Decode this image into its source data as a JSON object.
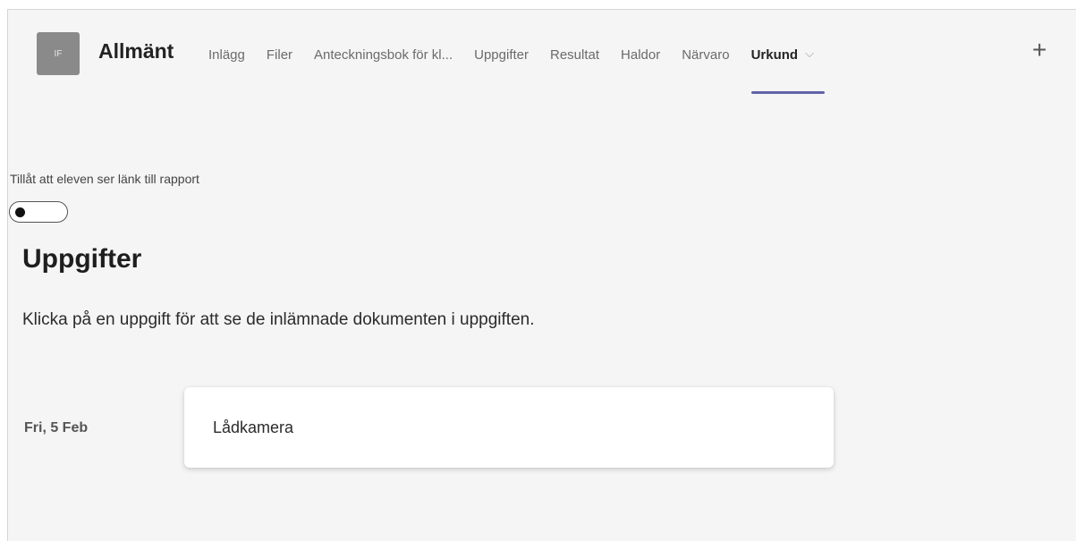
{
  "header": {
    "avatar_initials": "IF",
    "channel_title": "Allmänt",
    "tabs": [
      {
        "label": "Inlägg"
      },
      {
        "label": "Filer"
      },
      {
        "label": "Anteckningsbok för kl..."
      },
      {
        "label": "Uppgifter"
      },
      {
        "label": "Resultat"
      },
      {
        "label": "Haldor"
      },
      {
        "label": "Närvaro"
      },
      {
        "label": "Urkund",
        "active": true
      }
    ],
    "dropdown_glyph": "⌵",
    "add_tab_glyph": "+"
  },
  "settings": {
    "toggle_label": "Tillåt att eleven ser länk till rapport",
    "toggle_on": false
  },
  "assignments": {
    "title": "Uppgifter",
    "description": "Klicka på en uppgift för att se de inlämnade dokumenten i uppgiften.",
    "items": [
      {
        "date": "Fri, 5 Feb",
        "name": "Lådkamera"
      }
    ]
  },
  "colors": {
    "accent": "#6264a7",
    "avatar_bg": "#8a8a8a",
    "background": "#f5f5f5"
  },
  "icons": {
    "dropdown": "chevron-down-icon",
    "add": "plus-icon",
    "toggle_knob": "toggle-knob"
  }
}
